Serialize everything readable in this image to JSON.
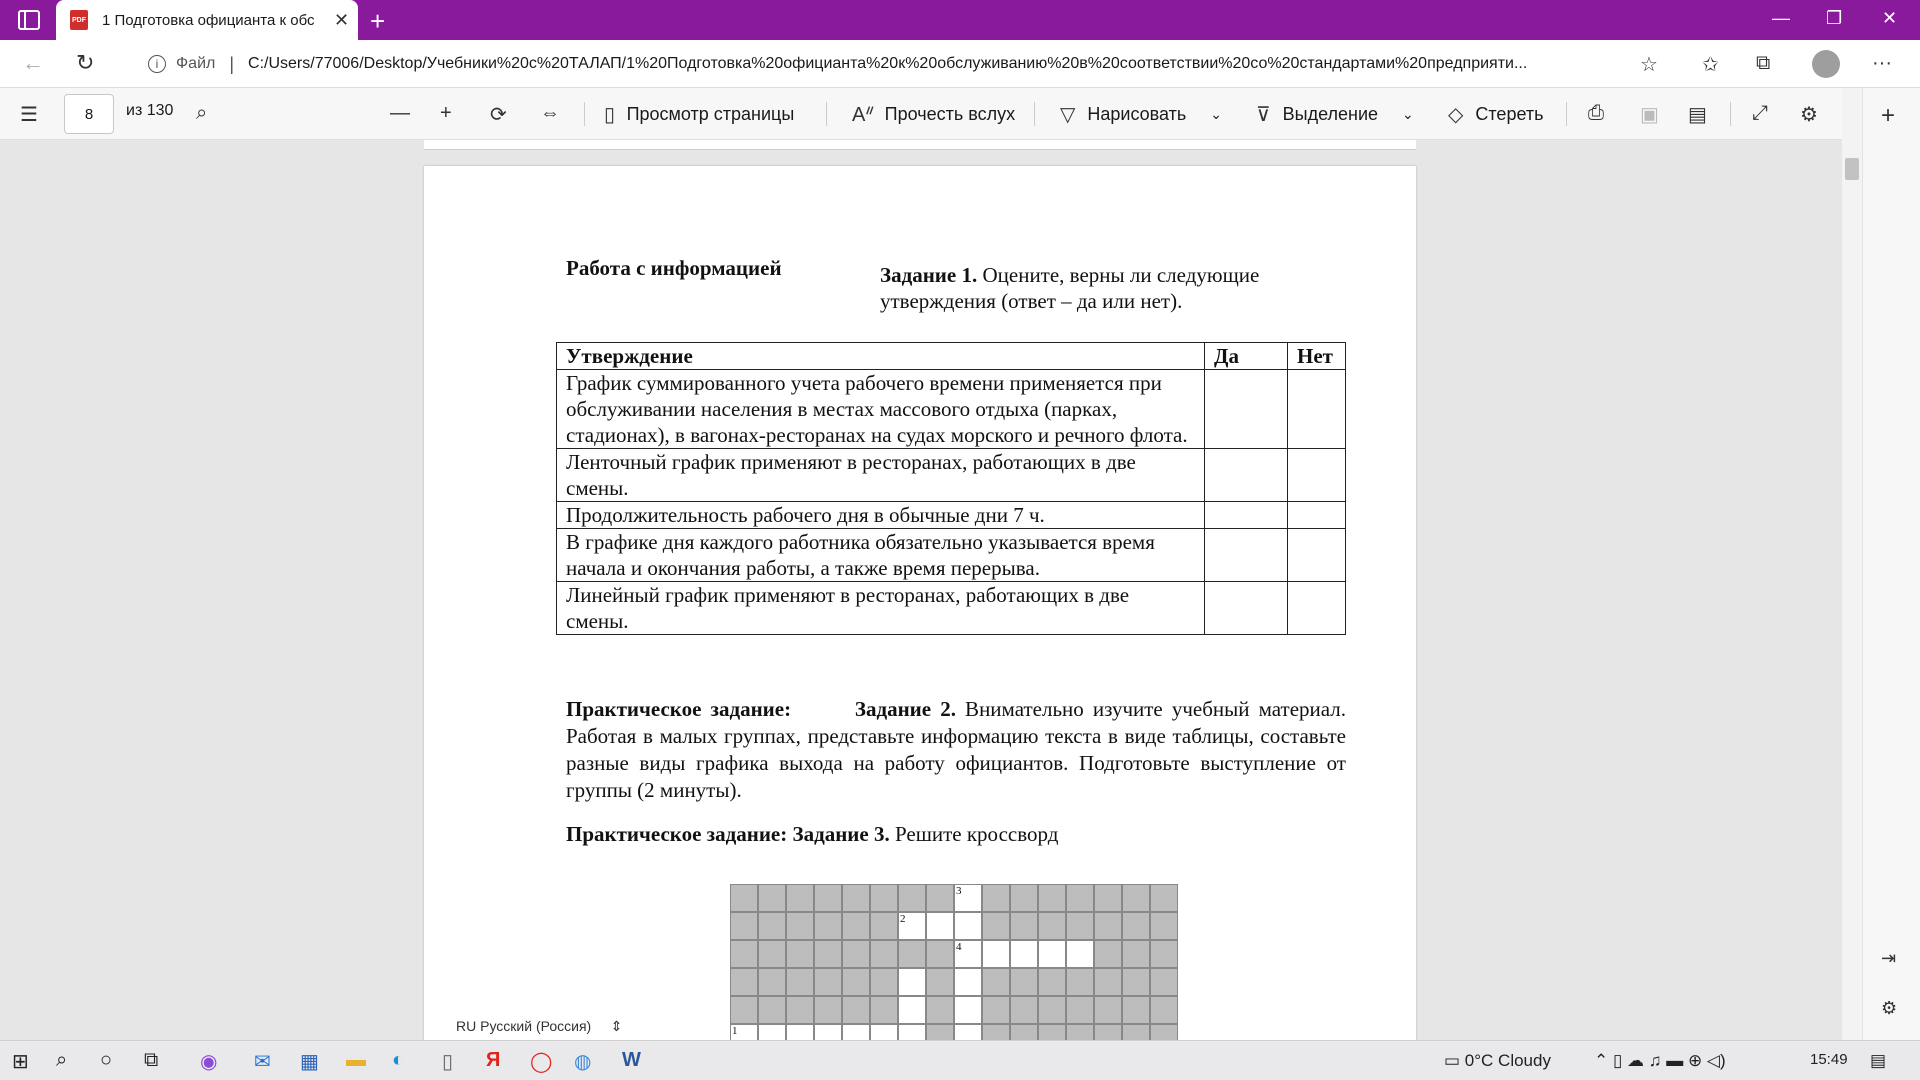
{
  "browser": {
    "tab_title": "1 Подготовка официанта к обс",
    "pdf_badge": "PDF",
    "file_label": "Файл",
    "url": "C:/Users/77006/Desktop/Учебники%20с%20ТАЛАП/1%20Подготовка%20официанта%20к%20обслуживанию%20в%20соответствии%20со%20стандартами%20предприяти..."
  },
  "pdf_toolbar": {
    "page_number": "8",
    "page_total": "из 130",
    "page_view": "Просмотр страницы",
    "read_aloud": "Прочесть вслух",
    "draw": "Нарисовать",
    "highlight": "Выделение",
    "erase": "Стереть"
  },
  "document": {
    "section_heading": "Работа с информацией",
    "task1_label": "Задание 1.",
    "task1_text": " Оцените, верны ли следующие утверждения (ответ – да или нет).",
    "table_headers": [
      "Утверждение",
      "Да",
      "Нет"
    ],
    "table_rows": [
      "График суммированного учета рабочего времени применяется при обслуживании населения в местах массового отдыха (парках, стадионах), в вагонах-ресторанах на судах морского и речного флота.",
      "Ленточный график применяют в ресторанах, работающих в две смены.",
      "Продолжительность рабочего дня в обычные дни 7 ч.",
      "В графике дня каждого работника обязательно указывается время начала и окончания работы, а также время перерыва.",
      "Линейный график применяют в ресторанах, работающих в две смены."
    ],
    "task2_label": "Практическое задание:",
    "task2_bold": "Задание 2.",
    "task2_text": " Внимательно изучите учебный материал. Работая в малых группах, представьте информацию текста в виде таблицы, составьте разные виды графика выхода на работу официантов. Подготовьте выступление от группы (2 минуты).",
    "task3_bold": "Практическое задание: Задание 3.",
    "task3_text": " Решите кроссворд",
    "crossword_numbers": [
      "1",
      "2",
      "3",
      "4"
    ]
  },
  "language_bar": "RU Русский (Россия)",
  "taskbar": {
    "weather": "0°C  Cloudy",
    "time": "15:49"
  }
}
